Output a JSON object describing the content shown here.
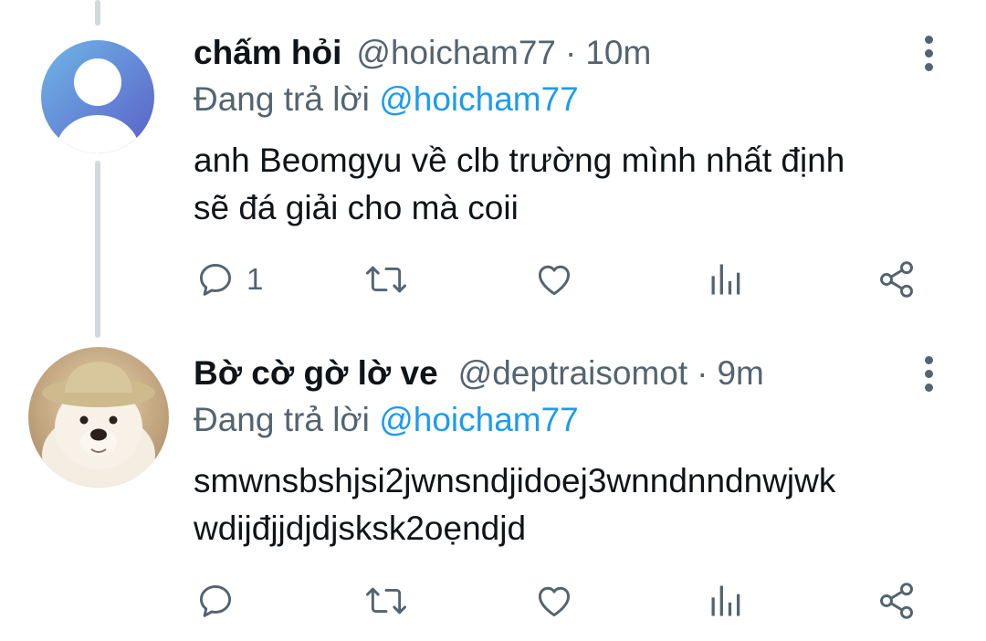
{
  "tweets": [
    {
      "name": "chấm hỏi",
      "handle": "@hoicham77",
      "separator": "·",
      "time": "10m",
      "replying_prefix": "Đang trả lời ",
      "replying_to": "@hoicham77",
      "text_lines": [
        "anh Beomgyu về clb trường mình nhất định",
        "sẽ đá giải cho mà coii"
      ],
      "reply_count": "1",
      "avatar": "default-avatar-icon"
    },
    {
      "name": "Bờ cờ gờ lờ ve",
      "handle": "@deptraisomot",
      "separator": "·",
      "time": "9m",
      "replying_prefix": "Đang trả lời ",
      "replying_to": "@hoicham77",
      "text_lines": [
        "smwnsbshjsi2jwnsndjidoej3wnndnndnwjwk",
        "wdijđjjdjdjsksk2oẹndjd"
      ],
      "reply_count": "",
      "avatar": "dog-photo-avatar"
    }
  ],
  "colors": {
    "text": "#0f1419",
    "secondary": "#536471",
    "link": "#1d9bf0",
    "thread_line": "#cfd9de"
  },
  "icons": [
    "reply-icon",
    "retweet-icon",
    "like-icon",
    "analytics-icon",
    "share-icon",
    "more-icon"
  ]
}
